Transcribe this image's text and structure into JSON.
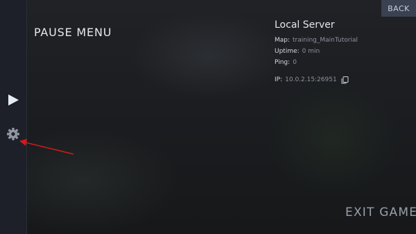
{
  "menu": {
    "title": "PAUSE MENU",
    "back_label": "BACK",
    "exit_label": "EXIT GAME"
  },
  "rail": {
    "items": [
      {
        "icon": "play-icon"
      },
      {
        "icon": "gear-icon"
      }
    ]
  },
  "server": {
    "title": "Local Server",
    "map_label": "Map:",
    "map_value": "training_MainTutorial",
    "uptime_label": "Uptime:",
    "uptime_value": "0 min",
    "ping_label": "Ping:",
    "ping_value": "0",
    "ip_label": "IP:",
    "ip_value": "10.0.2.15:26951"
  },
  "colors": {
    "annotation_arrow": "#d11a1a",
    "rail_background": "#1d2028",
    "back_button": "#3a4150"
  }
}
